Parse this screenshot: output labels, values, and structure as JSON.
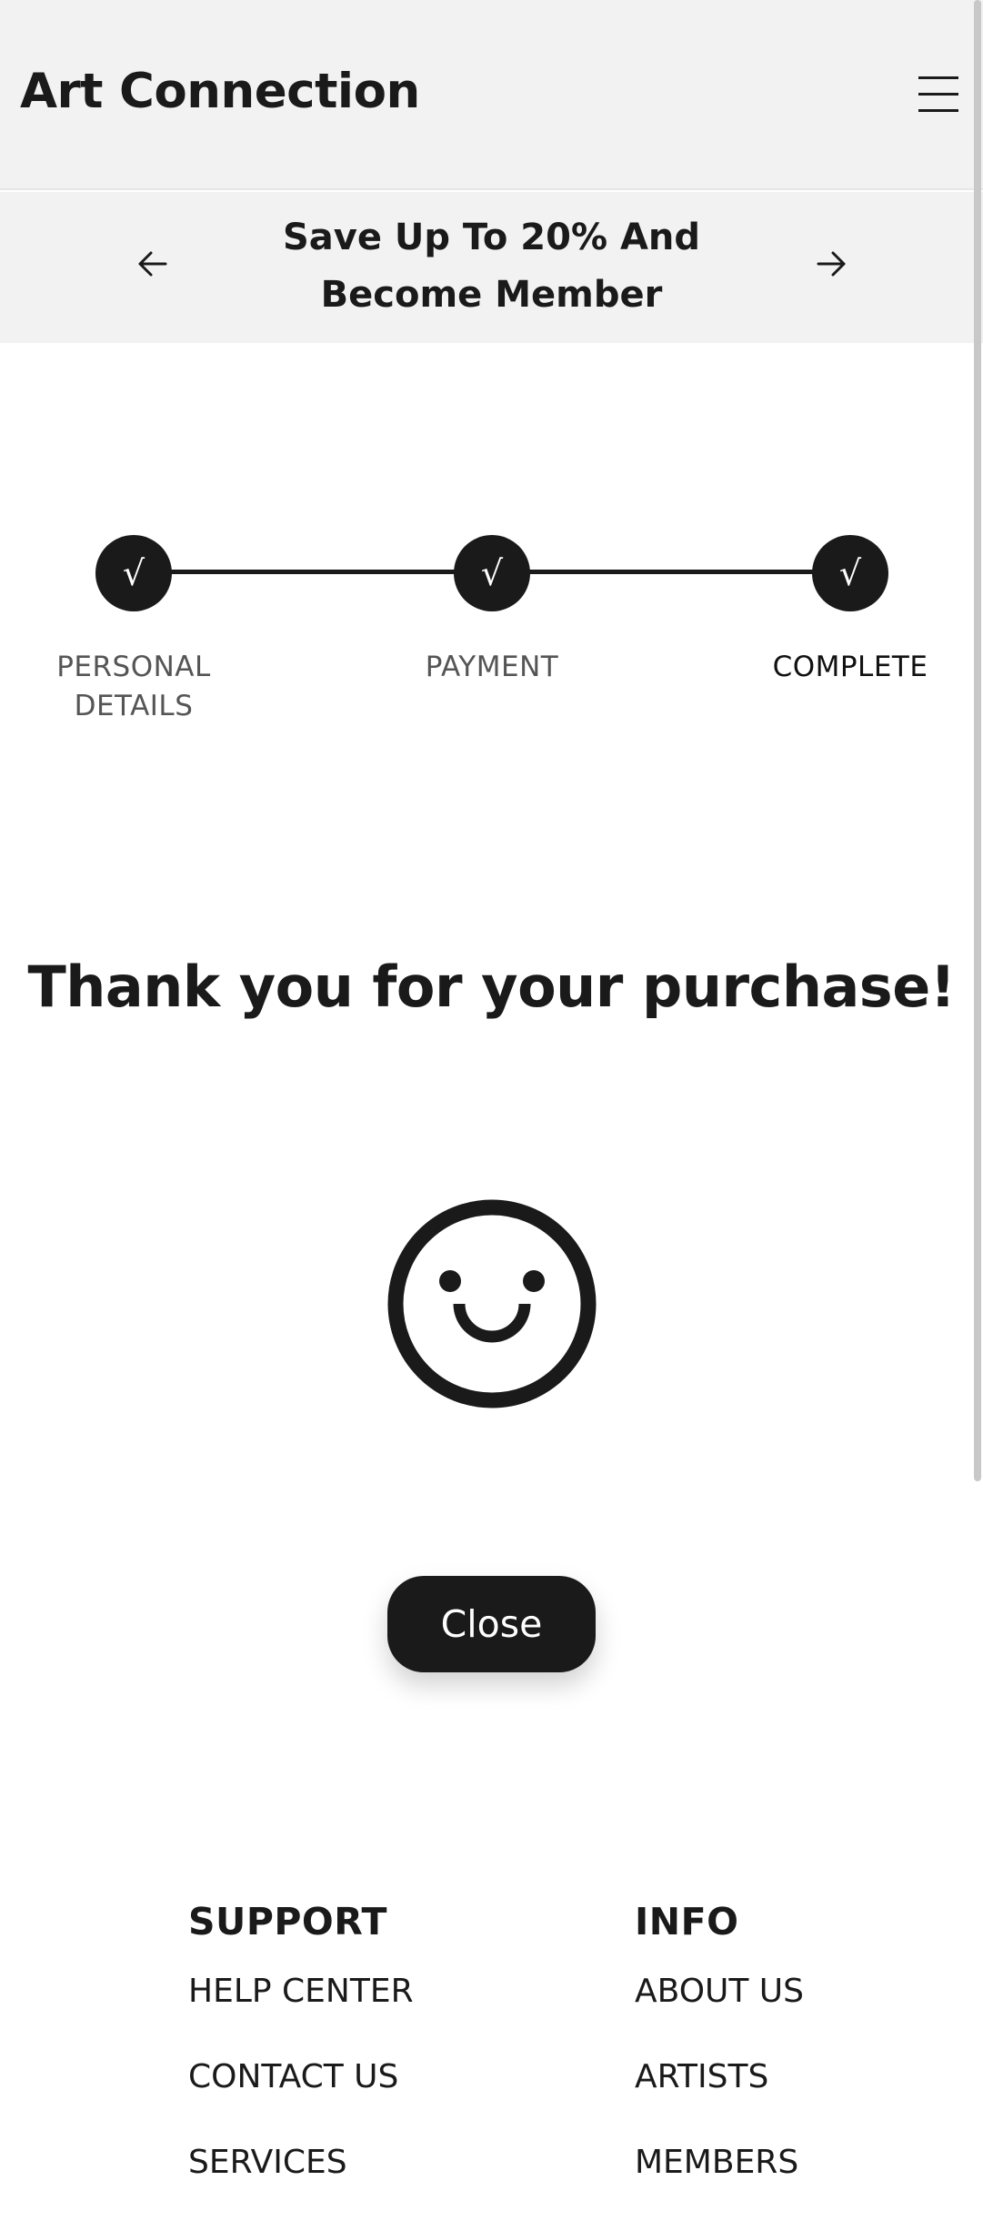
{
  "header": {
    "app_title": "Art Connection",
    "menu_icon": "hamburger-menu-icon"
  },
  "promo": {
    "line1": "Save Up To 20% And",
    "line2": "Become Member",
    "prev_icon": "arrow-left-icon",
    "next_icon": "arrow-right-icon"
  },
  "stepper": {
    "steps": [
      {
        "line1": "PERSONAL",
        "line2": "DETAILS",
        "completed": true,
        "active": false
      },
      {
        "line1": "PAYMENT",
        "line2": "",
        "completed": true,
        "active": false
      },
      {
        "line1": "COMPLETE",
        "line2": "",
        "completed": true,
        "active": true
      }
    ],
    "check_glyph": "√"
  },
  "main": {
    "thank_you_title": "Thank you for your purchase!",
    "smiley_icon": "smiley-face-icon",
    "close_label": "Close"
  },
  "footer": {
    "support": {
      "heading": "SUPPORT",
      "links": [
        "HELP CENTER",
        "CONTACT US",
        "SERVICES"
      ]
    },
    "info": {
      "heading": "INFO",
      "links": [
        "ABOUT US",
        "ARTISTS",
        "MEMBERS"
      ]
    }
  },
  "colors": {
    "primary": "#1a1a1a",
    "header_bg": "#f2f2f2",
    "muted_text": "#555555"
  }
}
